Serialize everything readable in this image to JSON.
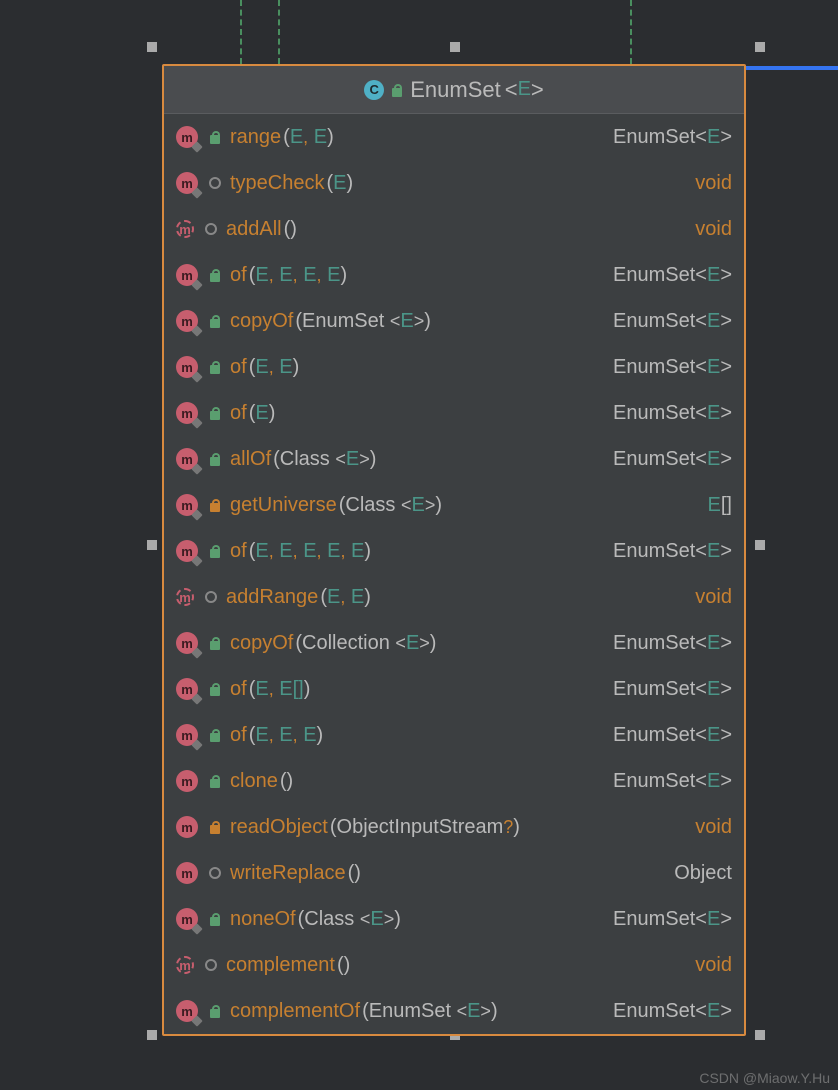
{
  "class": {
    "icon_letter": "C",
    "name": "EnumSet",
    "type_param": "E"
  },
  "icon_letters": {
    "m": "m"
  },
  "methods": [
    {
      "icon": "m-static",
      "mod": "green",
      "name": "range",
      "params": [
        {
          "t": "E"
        },
        {
          "t": "E"
        }
      ],
      "ret": "EnumSet<E>"
    },
    {
      "icon": "m-static",
      "mod": "circle",
      "name": "typeCheck",
      "params": [
        {
          "t": "E"
        }
      ],
      "ret": "void"
    },
    {
      "icon": "m-abstract",
      "mod": "circle",
      "name": "addAll",
      "params": [],
      "ret": "void"
    },
    {
      "icon": "m-static",
      "mod": "green",
      "name": "of",
      "params": [
        {
          "t": "E"
        },
        {
          "t": "E"
        },
        {
          "t": "E"
        },
        {
          "t": "E"
        }
      ],
      "ret": "EnumSet<E>"
    },
    {
      "icon": "m-static",
      "mod": "green",
      "name": "copyOf",
      "params": [
        {
          "t": "EnumSet",
          "g": "E"
        }
      ],
      "ret": "EnumSet<E>"
    },
    {
      "icon": "m-static",
      "mod": "green",
      "name": "of",
      "params": [
        {
          "t": "E"
        },
        {
          "t": "E"
        }
      ],
      "ret": "EnumSet<E>"
    },
    {
      "icon": "m-static",
      "mod": "green",
      "name": "of",
      "params": [
        {
          "t": "E"
        }
      ],
      "ret": "EnumSet<E>"
    },
    {
      "icon": "m-static",
      "mod": "green",
      "name": "allOf",
      "params": [
        {
          "t": "Class",
          "g": "E"
        }
      ],
      "ret": "EnumSet<E>"
    },
    {
      "icon": "m-static",
      "mod": "orange",
      "name": "getUniverse",
      "params": [
        {
          "t": "Class",
          "g": "E"
        }
      ],
      "ret": "E[]"
    },
    {
      "icon": "m-static",
      "mod": "green",
      "name": "of",
      "params": [
        {
          "t": "E"
        },
        {
          "t": "E"
        },
        {
          "t": "E"
        },
        {
          "t": "E"
        },
        {
          "t": "E"
        }
      ],
      "ret": "EnumSet<E>"
    },
    {
      "icon": "m-abstract",
      "mod": "circle",
      "name": "addRange",
      "params": [
        {
          "t": "E"
        },
        {
          "t": "E"
        }
      ],
      "ret": "void"
    },
    {
      "icon": "m-static",
      "mod": "green",
      "name": "copyOf",
      "params": [
        {
          "t": "Collection",
          "g": "E"
        }
      ],
      "ret": "EnumSet<E>"
    },
    {
      "icon": "m-static",
      "mod": "green",
      "name": "of",
      "params": [
        {
          "t": "E"
        },
        {
          "t": "E[]"
        }
      ],
      "ret": "EnumSet<E>"
    },
    {
      "icon": "m-static",
      "mod": "green",
      "name": "of",
      "params": [
        {
          "t": "E"
        },
        {
          "t": "E"
        },
        {
          "t": "E"
        }
      ],
      "ret": "EnumSet<E>"
    },
    {
      "icon": "m",
      "mod": "green",
      "name": "clone",
      "params": [],
      "ret": "EnumSet<E>"
    },
    {
      "icon": "m",
      "mod": "orange",
      "name": "readObject",
      "params": [
        {
          "t": "ObjectInputStream",
          "nullable": true
        }
      ],
      "ret": "void"
    },
    {
      "icon": "m",
      "mod": "circle",
      "name": "writeReplace",
      "params": [],
      "ret": "Object"
    },
    {
      "icon": "m-static",
      "mod": "green",
      "name": "noneOf",
      "params": [
        {
          "t": "Class",
          "g": "E"
        }
      ],
      "ret": "EnumSet<E>"
    },
    {
      "icon": "m-abstract",
      "mod": "circle",
      "name": "complement",
      "params": [],
      "ret": "void"
    },
    {
      "icon": "m-static",
      "mod": "green",
      "name": "complementOf",
      "params": [
        {
          "t": "EnumSet",
          "g": "E"
        }
      ],
      "ret": "EnumSet<E>"
    }
  ],
  "watermark": "CSDN @Miaow.Y.Hu"
}
